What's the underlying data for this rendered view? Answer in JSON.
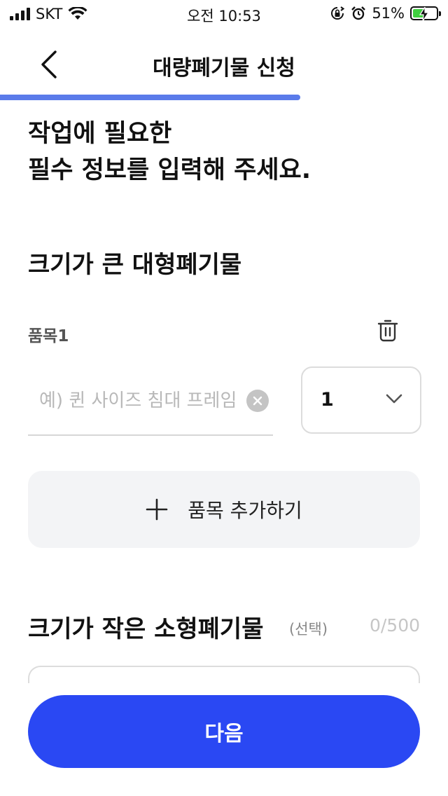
{
  "status_bar": {
    "carrier": "SKT",
    "time": "오전 10:53",
    "battery_percent": "51%",
    "battery_level": 0.51,
    "icons": [
      "signal-icon",
      "wifi-icon",
      "orientation-lock-icon",
      "alarm-icon",
      "battery-icon",
      "charging-bolt-icon"
    ]
  },
  "header": {
    "title": "대량폐기물 신청",
    "back_icon": "chevron-left-icon",
    "progress": 0.67
  },
  "intro": {
    "line1": "작업에 필요한",
    "line2": "필수 정보를 입력해 주세요."
  },
  "large_section": {
    "title": "크기가 큰 대형폐기물",
    "item_label": "품목1",
    "delete_icon": "trash-icon",
    "item_placeholder": "예) 퀸 사이즈 침대 프레임",
    "clear_icon": "clear-icon",
    "quantity": "1",
    "quantity_icon": "chevron-down-icon",
    "add_item_label": "품목 추가하기",
    "add_icon": "plus-icon"
  },
  "small_section": {
    "title": "크기가 작은 소형폐기물",
    "optional": "(선택)",
    "char_count": "0/500"
  },
  "footer": {
    "next_label": "다음"
  },
  "colors": {
    "primary": "#2a48f3",
    "progress": "#5a7bea",
    "add_button_bg": "#f3f4f6"
  }
}
